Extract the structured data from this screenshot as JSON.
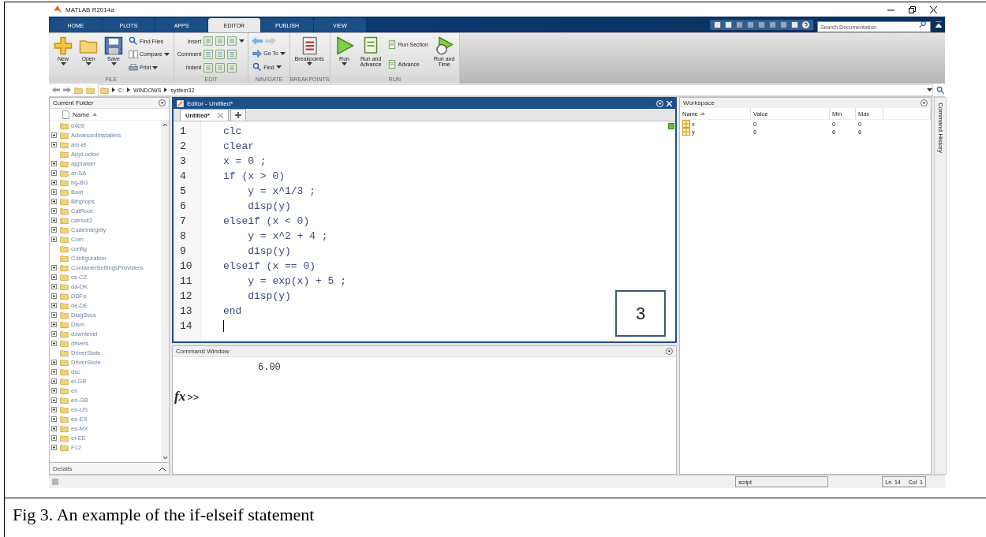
{
  "window": {
    "title": "MATLAB R2014a"
  },
  "tabs": [
    {
      "label": "HOME",
      "selected": false
    },
    {
      "label": "PLOTS",
      "selected": false
    },
    {
      "label": "APPS",
      "selected": false
    },
    {
      "label": "EDITOR",
      "selected": true
    },
    {
      "label": "PUBLISH",
      "selected": false
    },
    {
      "label": "VIEW",
      "selected": false
    }
  ],
  "search": {
    "placeholder": "Search Documentation"
  },
  "toolstrip": [
    {
      "label": "FILE",
      "items": [
        {
          "kind": "big",
          "label": "New",
          "dropdown": true
        },
        {
          "kind": "big",
          "label": "Open",
          "dropdown": true
        },
        {
          "kind": "big",
          "label": "Save",
          "dropdown": true
        },
        {
          "kind": "small",
          "label": "Find Files",
          "dropdown": false
        },
        {
          "kind": "small",
          "label": "Compare",
          "dropdown": true
        },
        {
          "kind": "small",
          "label": "Print",
          "dropdown": true
        }
      ]
    },
    {
      "label": "EDIT",
      "items": [
        {
          "kind": "row",
          "label": "Insert",
          "dropdown": true
        },
        {
          "kind": "row",
          "label": "Comment",
          "dropdown": false
        },
        {
          "kind": "row",
          "label": "Indent",
          "dropdown": false
        }
      ]
    },
    {
      "label": "NAVIGATE",
      "items": [
        {
          "kind": "arrows"
        },
        {
          "kind": "small",
          "label": "Go To",
          "dropdown": true
        },
        {
          "kind": "small",
          "label": "Find",
          "dropdown": true
        }
      ]
    },
    {
      "label": "BREAKPOINTS",
      "items": [
        {
          "kind": "big",
          "label": "Breakpoints",
          "dropdown": true
        }
      ]
    },
    {
      "label": "RUN",
      "items": [
        {
          "kind": "big",
          "label": "Run",
          "dropdown": true
        },
        {
          "kind": "big",
          "label": "Run and\nAdvance",
          "dropdown": false
        },
        {
          "kind": "small",
          "label": "Run Section",
          "dropdown": false
        },
        {
          "kind": "small",
          "label": "Advance",
          "dropdown": false
        },
        {
          "kind": "big",
          "label": "Run and\nTime",
          "dropdown": false
        }
      ]
    }
  ],
  "address": {
    "path": [
      "C:",
      "WINDOWS",
      "system32"
    ]
  },
  "folder": {
    "title": "Current Folder",
    "column": "Name",
    "items": [
      {
        "name": "0409",
        "expandable": false
      },
      {
        "name": "AdvancedInstallers",
        "expandable": true
      },
      {
        "name": "am-et",
        "expandable": true
      },
      {
        "name": "AppLocker",
        "expandable": false
      },
      {
        "name": "appraiser",
        "expandable": true
      },
      {
        "name": "ar-SA",
        "expandable": true
      },
      {
        "name": "bg-BG",
        "expandable": true
      },
      {
        "name": "Boot",
        "expandable": true
      },
      {
        "name": "Bthprops",
        "expandable": true
      },
      {
        "name": "CatRoot",
        "expandable": true
      },
      {
        "name": "catroot2",
        "expandable": true
      },
      {
        "name": "CodeIntegrity",
        "expandable": true
      },
      {
        "name": "Com",
        "expandable": true
      },
      {
        "name": "config",
        "expandable": false
      },
      {
        "name": "Configuration",
        "expandable": false
      },
      {
        "name": "ContainerSettingsProviders",
        "expandable": true
      },
      {
        "name": "cs-CZ",
        "expandable": true
      },
      {
        "name": "da-DK",
        "expandable": true
      },
      {
        "name": "DDFs",
        "expandable": true
      },
      {
        "name": "de-DE",
        "expandable": true
      },
      {
        "name": "DiagSvcs",
        "expandable": true
      },
      {
        "name": "Dism",
        "expandable": true
      },
      {
        "name": "downlevel",
        "expandable": true
      },
      {
        "name": "drivers",
        "expandable": true
      },
      {
        "name": "DriverState",
        "expandable": false
      },
      {
        "name": "DriverStore",
        "expandable": true
      },
      {
        "name": "dsc",
        "expandable": true
      },
      {
        "name": "el-GR",
        "expandable": true
      },
      {
        "name": "en",
        "expandable": true
      },
      {
        "name": "en-GB",
        "expandable": true
      },
      {
        "name": "en-US",
        "expandable": true
      },
      {
        "name": "es-ES",
        "expandable": true
      },
      {
        "name": "es-MX",
        "expandable": true
      },
      {
        "name": "et-EE",
        "expandable": true
      },
      {
        "name": "F12",
        "expandable": true
      }
    ],
    "details": "Details"
  },
  "editor": {
    "title": "Editor - Untitled*",
    "tabs": [
      {
        "label": "Untitled*",
        "selected": true
      }
    ],
    "lines": [
      {
        "number": "1",
        "text": "clc",
        "cursor": false
      },
      {
        "number": "2",
        "text": "clear",
        "cursor": false
      },
      {
        "number": "3",
        "text": "x = 0 ;",
        "cursor": false
      },
      {
        "number": "4",
        "text": "if (x > 0)",
        "cursor": false
      },
      {
        "number": "5",
        "text": "    y = x^1/3 ;",
        "cursor": false
      },
      {
        "number": "6",
        "text": "    disp(y)",
        "cursor": false
      },
      {
        "number": "7",
        "text": "elseif (x < 0)",
        "cursor": false
      },
      {
        "number": "8",
        "text": "    y = x^2 + 4 ;",
        "cursor": false
      },
      {
        "number": "9",
        "text": "    disp(y)",
        "cursor": false
      },
      {
        "number": "10",
        "text": "elseif (x == 0)",
        "cursor": false
      },
      {
        "number": "11",
        "text": "    y = exp(x) + 5 ;",
        "cursor": false
      },
      {
        "number": "12",
        "text": "    disp(y)",
        "cursor": false
      },
      {
        "number": "13",
        "text": "end",
        "cursor": false
      },
      {
        "number": "14",
        "cursor": true
      }
    ],
    "annotation": "3"
  },
  "command_window": {
    "title": "Command Window",
    "output": "6.00",
    "prompt_icon": "fx",
    "prompt": ">>"
  },
  "workspace": {
    "title": "Workspace",
    "columns": [
      "Name",
      "Value",
      "Min",
      "Max"
    ],
    "rows": [
      {
        "name": "x",
        "value": "0",
        "min": "0",
        "max": "0"
      },
      {
        "name": "y",
        "value": "6",
        "min": "6",
        "max": "6"
      }
    ]
  },
  "side_tab": "Command History",
  "status_bar": {
    "type": "script",
    "ln_label": "Ln",
    "ln": "14",
    "col_label": "Col",
    "col": "1"
  },
  "caption": "Fig 3. An example of the if-elseif statement"
}
